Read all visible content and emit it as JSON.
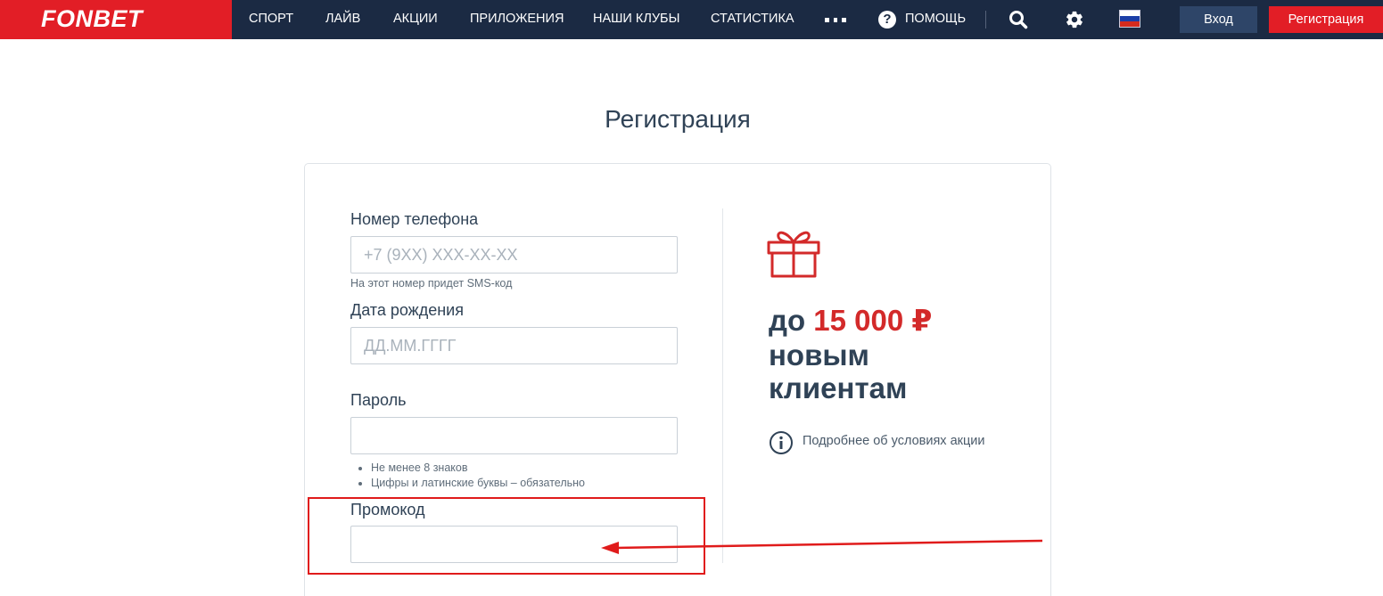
{
  "brand": {
    "name": "FONBET",
    "red": "#e21e26",
    "navy": "#1b2a43"
  },
  "nav": {
    "items": [
      {
        "label": "СПОРТ"
      },
      {
        "label": "ЛАЙВ"
      },
      {
        "label": "АКЦИИ"
      },
      {
        "label": "ПРИЛОЖЕНИЯ"
      },
      {
        "label": "НАШИ КЛУБЫ"
      },
      {
        "label": "СТАТИСТИКА"
      }
    ],
    "more_icon": "more-dots-icon",
    "help_label": "ПОМОЩЬ",
    "search_icon": "search-icon",
    "settings_icon": "gear-icon",
    "language_flag": "russia-flag-icon",
    "login_label": "Вход",
    "register_label": "Регистрация"
  },
  "page": {
    "title": "Регистрация"
  },
  "form": {
    "phone": {
      "label": "Номер телефона",
      "placeholder": "+7 (9XX) XXX-XX-XX",
      "value": "",
      "hint": "На этот номер придет SMS-код"
    },
    "birthdate": {
      "label": "Дата рождения",
      "placeholder": "ДД.ММ.ГГГГ",
      "value": ""
    },
    "password": {
      "label": "Пароль",
      "value": "",
      "rules": [
        "Не менее 8 знаков",
        "Цифры и латинские буквы – обязательно"
      ]
    },
    "promo": {
      "label": "Промокод",
      "value": ""
    }
  },
  "promo_panel": {
    "prefix": "до ",
    "amount": "15 000 ₽",
    "line2": "новым",
    "line3": "клиентам",
    "details_link": "Подробнее об условиях акции",
    "accent": "#d32a2a"
  },
  "annotation": {
    "color": "#e01b1b"
  }
}
